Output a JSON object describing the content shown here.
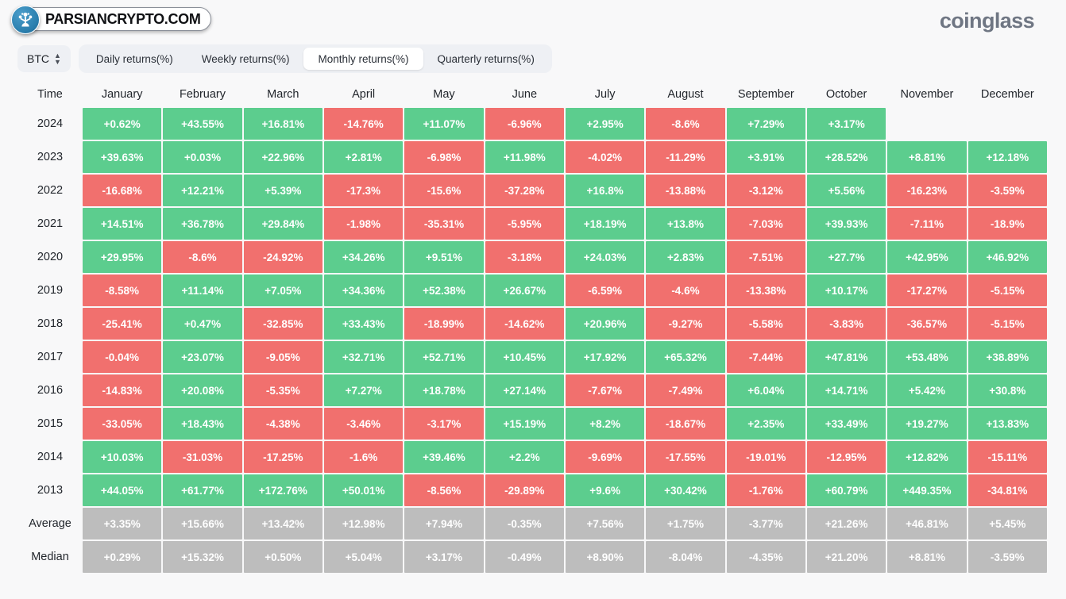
{
  "header": {
    "title": "(%)",
    "brand": "coinglass"
  },
  "watermark": {
    "text": "PARSIANCRYPTO.COM",
    "icon": "parsiancrypto-tree-logo-icon"
  },
  "toolbar": {
    "symbol": "BTC",
    "symbol_caret": "sort-caret-icon",
    "tabs": [
      {
        "label": "Daily returns(%)",
        "active": false
      },
      {
        "label": "Weekly returns(%)",
        "active": false
      },
      {
        "label": "Monthly returns(%)",
        "active": true
      },
      {
        "label": "Quarterly returns(%)",
        "active": false
      }
    ]
  },
  "colors": {
    "positive": "#5ccd8e",
    "negative": "#f1706e",
    "stat": "#bdbdbd",
    "background": "#f8f8f9",
    "text": "#22262c"
  },
  "chart_data": {
    "type": "heatmap",
    "title": "(%)",
    "xlabel": "",
    "ylabel": "Time",
    "legend_position": "none",
    "grid": false,
    "columns": [
      "Time",
      "January",
      "February",
      "March",
      "April",
      "May",
      "June",
      "July",
      "August",
      "September",
      "October",
      "November",
      "December"
    ],
    "categories": [
      "January",
      "February",
      "March",
      "April",
      "May",
      "June",
      "July",
      "August",
      "September",
      "October",
      "November",
      "December"
    ],
    "rows": [
      {
        "label": "2024",
        "kind": "year",
        "values": [
          "+0.62%",
          "+43.55%",
          "+16.81%",
          "-14.76%",
          "+11.07%",
          "-6.96%",
          "+2.95%",
          "-8.6%",
          "+7.29%",
          "+3.17%",
          "",
          ""
        ]
      },
      {
        "label": "2023",
        "kind": "year",
        "values": [
          "+39.63%",
          "+0.03%",
          "+22.96%",
          "+2.81%",
          "-6.98%",
          "+11.98%",
          "-4.02%",
          "-11.29%",
          "+3.91%",
          "+28.52%",
          "+8.81%",
          "+12.18%"
        ]
      },
      {
        "label": "2022",
        "kind": "year",
        "values": [
          "-16.68%",
          "+12.21%",
          "+5.39%",
          "-17.3%",
          "-15.6%",
          "-37.28%",
          "+16.8%",
          "-13.88%",
          "-3.12%",
          "+5.56%",
          "-16.23%",
          "-3.59%"
        ]
      },
      {
        "label": "2021",
        "kind": "year",
        "values": [
          "+14.51%",
          "+36.78%",
          "+29.84%",
          "-1.98%",
          "-35.31%",
          "-5.95%",
          "+18.19%",
          "+13.8%",
          "-7.03%",
          "+39.93%",
          "-7.11%",
          "-18.9%"
        ]
      },
      {
        "label": "2020",
        "kind": "year",
        "values": [
          "+29.95%",
          "-8.6%",
          "-24.92%",
          "+34.26%",
          "+9.51%",
          "-3.18%",
          "+24.03%",
          "+2.83%",
          "-7.51%",
          "+27.7%",
          "+42.95%",
          "+46.92%"
        ]
      },
      {
        "label": "2019",
        "kind": "year",
        "values": [
          "-8.58%",
          "+11.14%",
          "+7.05%",
          "+34.36%",
          "+52.38%",
          "+26.67%",
          "-6.59%",
          "-4.6%",
          "-13.38%",
          "+10.17%",
          "-17.27%",
          "-5.15%"
        ]
      },
      {
        "label": "2018",
        "kind": "year",
        "values": [
          "-25.41%",
          "+0.47%",
          "-32.85%",
          "+33.43%",
          "-18.99%",
          "-14.62%",
          "+20.96%",
          "-9.27%",
          "-5.58%",
          "-3.83%",
          "-36.57%",
          "-5.15%"
        ]
      },
      {
        "label": "2017",
        "kind": "year",
        "values": [
          "-0.04%",
          "+23.07%",
          "-9.05%",
          "+32.71%",
          "+52.71%",
          "+10.45%",
          "+17.92%",
          "+65.32%",
          "-7.44%",
          "+47.81%",
          "+53.48%",
          "+38.89%"
        ]
      },
      {
        "label": "2016",
        "kind": "year",
        "values": [
          "-14.83%",
          "+20.08%",
          "-5.35%",
          "+7.27%",
          "+18.78%",
          "+27.14%",
          "-7.67%",
          "-7.49%",
          "+6.04%",
          "+14.71%",
          "+5.42%",
          "+30.8%"
        ]
      },
      {
        "label": "2015",
        "kind": "year",
        "values": [
          "-33.05%",
          "+18.43%",
          "-4.38%",
          "-3.46%",
          "-3.17%",
          "+15.19%",
          "+8.2%",
          "-18.67%",
          "+2.35%",
          "+33.49%",
          "+19.27%",
          "+13.83%"
        ]
      },
      {
        "label": "2014",
        "kind": "year",
        "values": [
          "+10.03%",
          "-31.03%",
          "-17.25%",
          "-1.6%",
          "+39.46%",
          "+2.2%",
          "-9.69%",
          "-17.55%",
          "-19.01%",
          "-12.95%",
          "+12.82%",
          "-15.11%"
        ]
      },
      {
        "label": "2013",
        "kind": "year",
        "values": [
          "+44.05%",
          "+61.77%",
          "+172.76%",
          "+50.01%",
          "-8.56%",
          "-29.89%",
          "+9.6%",
          "+30.42%",
          "-1.76%",
          "+60.79%",
          "+449.35%",
          "-34.81%"
        ]
      },
      {
        "label": "Average",
        "kind": "stat",
        "values": [
          "+3.35%",
          "+15.66%",
          "+13.42%",
          "+12.98%",
          "+7.94%",
          "-0.35%",
          "+7.56%",
          "+1.75%",
          "-3.77%",
          "+21.26%",
          "+46.81%",
          "+5.45%"
        ]
      },
      {
        "label": "Median",
        "kind": "stat",
        "values": [
          "+0.29%",
          "+15.32%",
          "+0.50%",
          "+5.04%",
          "+3.17%",
          "-0.49%",
          "+8.90%",
          "-8.04%",
          "-4.35%",
          "+21.20%",
          "+8.81%",
          "-3.59%"
        ]
      }
    ]
  }
}
